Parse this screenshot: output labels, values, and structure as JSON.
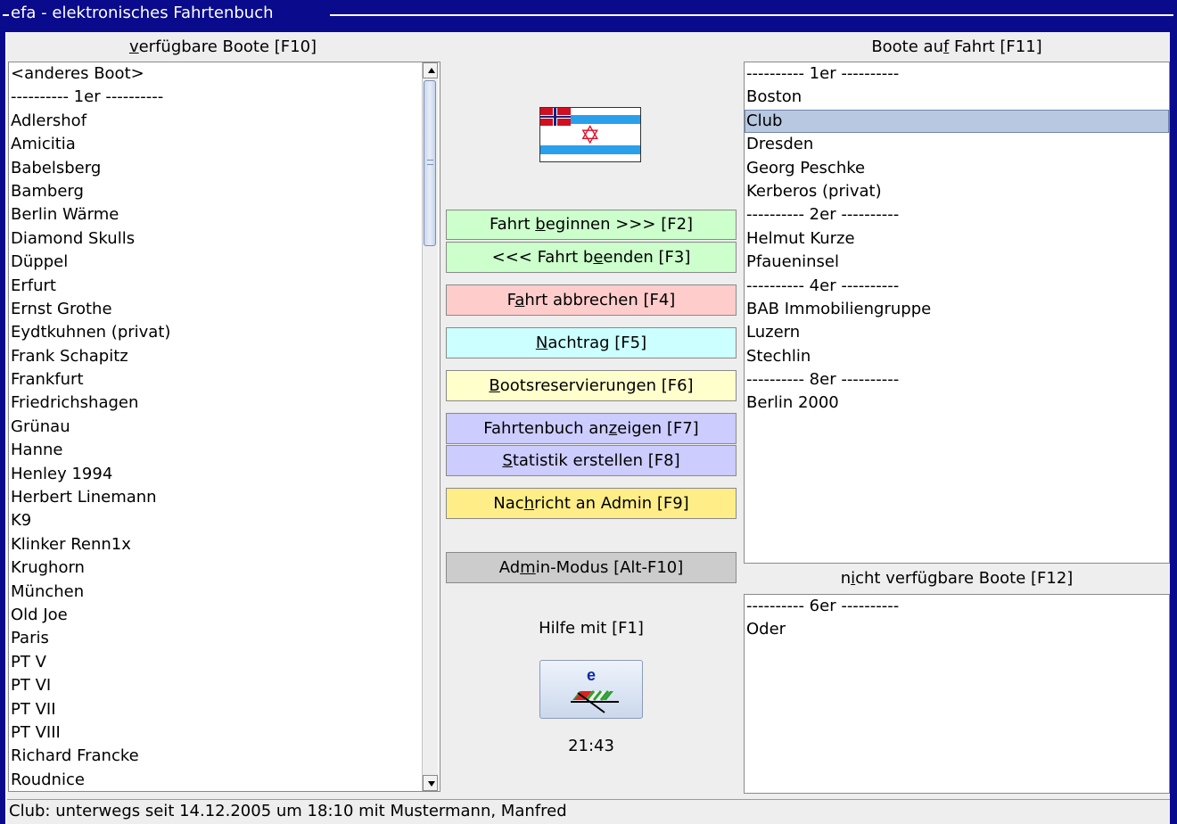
{
  "window": {
    "title": "efa - elektronisches Fahrtenbuch"
  },
  "available": {
    "label_parts": [
      "",
      "v",
      "erfügbare Boote [F10]"
    ],
    "items": [
      "<anderes Boot>",
      "---------- 1er ----------",
      "Adlershof",
      "Amicitia",
      "Babelsberg",
      "Bamberg",
      "Berlin Wärme",
      "Diamond Skulls",
      "Düppel",
      "Erfurt",
      "Ernst Grothe",
      "Eydtkuhnen (privat)",
      "Frank Schapitz",
      "Frankfurt",
      "Friedrichshagen",
      "Grünau",
      "Hanne",
      "Henley 1994",
      "Herbert Linemann",
      "K9",
      "Klinker Renn1x",
      "Krughorn",
      "München",
      "Old Joe",
      "Paris",
      "PT V",
      "PT VI",
      "PT VII",
      "PT VIII",
      "Richard Francke",
      "Roudnice"
    ]
  },
  "on_trip": {
    "label_parts": [
      "Boote au",
      "f",
      " Fahrt [F11]"
    ],
    "items": [
      "---------- 1er ----------",
      "Boston",
      "Club",
      "Dresden",
      "Georg Peschke",
      "Kerberos (privat)",
      "---------- 2er ----------",
      "Helmut Kurze",
      "Pfaueninsel",
      "---------- 4er ----------",
      "BAB Immobiliengruppe",
      "Luzern",
      "Stechlin",
      "---------- 8er ----------",
      "Berlin 2000"
    ],
    "selected": "Club"
  },
  "unavailable": {
    "label_parts": [
      "n",
      "i",
      "cht verfügbare Boote [F12]"
    ],
    "items": [
      "---------- 6er ----------",
      "Oder"
    ]
  },
  "buttons": {
    "start_trip": [
      "Fahrt ",
      "b",
      "eginnen >>> [F2]"
    ],
    "end_trip": [
      "<<< Fahrt b",
      "e",
      "enden [F3]"
    ],
    "cancel_trip": [
      "F",
      "a",
      "hrt abbrechen [F4]"
    ],
    "late_entry": [
      "",
      "N",
      "achtrag [F5]"
    ],
    "reservations": [
      "",
      "B",
      "ootsreservierungen [F6]"
    ],
    "show_logbook": [
      "Fahrtenbuch an",
      "z",
      "eigen [F7]"
    ],
    "statistics": [
      "",
      "S",
      "tatistik erstellen [F8]"
    ],
    "message_admin": [
      "Nac",
      "h",
      "richt an Admin [F9]"
    ],
    "admin_mode": [
      "Ad",
      "m",
      "in-Modus [Alt-F10]"
    ]
  },
  "colors": {
    "start_trip": "#ccffcc",
    "end_trip": "#ccffcc",
    "cancel_trip": "#ffcccc",
    "late_entry": "#ccffff",
    "reservations": "#ffffcc",
    "show_logbook": "#ccccff",
    "statistics": "#ccccff",
    "message_admin": "#ffee88",
    "admin_mode": "#cccccc"
  },
  "help_text": "Hilfe mit [F1]",
  "clock": "21:43",
  "status": "Club: unterwegs seit 14.12.2005 um 18:10 mit Mustermann, Manfred",
  "icons": {
    "flag": "club-flag-icon",
    "logo": "efa-logo-icon"
  }
}
